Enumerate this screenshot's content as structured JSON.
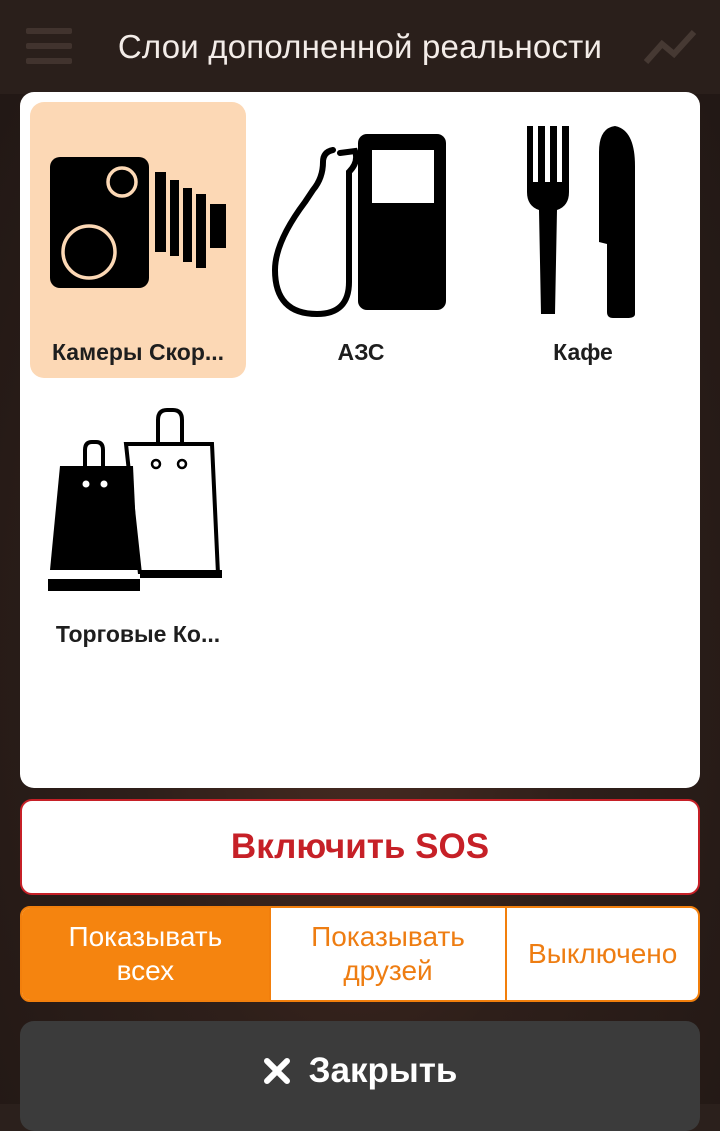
{
  "header": {
    "title": "Слои дополненной реальности",
    "menu_icon": "hamburger-menu-icon",
    "right_icon": "chart-trend-icon"
  },
  "layers": [
    {
      "label": "Камеры Скор...",
      "icon": "speed-camera-icon",
      "selected": true
    },
    {
      "label": "АЗС",
      "icon": "gas-station-icon",
      "selected": false
    },
    {
      "label": "Кафе",
      "icon": "fork-knife-icon",
      "selected": false
    },
    {
      "label": "Торговые Ко...",
      "icon": "shopping-bags-icon",
      "selected": false
    }
  ],
  "sos_button": {
    "label": "Включить SOS"
  },
  "visibility": {
    "options": [
      "Показывать всех",
      "Показывать друзей",
      "Выключено"
    ],
    "selected": "Показывать всех"
  },
  "close_button": {
    "label": "Закрыть",
    "icon": "close-icon"
  },
  "colors": {
    "accent_orange": "#f5840f",
    "sos_red": "#c62027",
    "selected_tile": "#fcd8b5",
    "close_bg": "#3b3b3b"
  }
}
